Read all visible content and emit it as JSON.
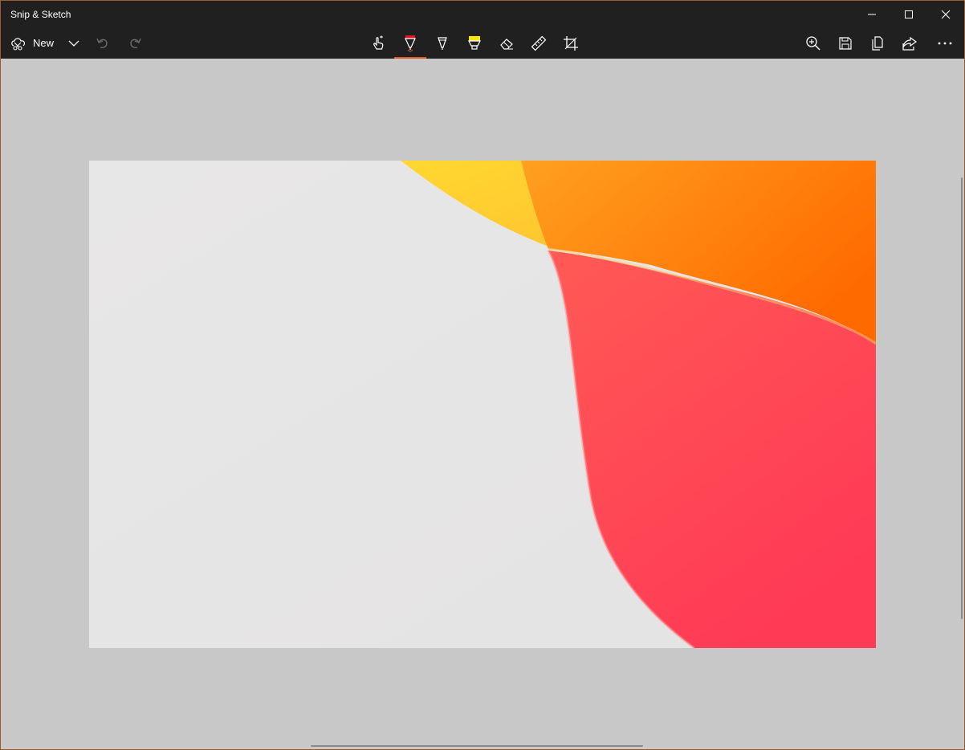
{
  "window": {
    "title": "Snip & Sketch",
    "controls": {
      "minimize_icon": "minimize-icon",
      "maximize_icon": "maximize-icon",
      "close_icon": "close-icon"
    }
  },
  "toolbar": {
    "new_label": "New",
    "left_tools": [
      "new-snip-icon",
      "chevron-down-icon",
      "undo-icon",
      "redo-icon"
    ],
    "center_tools": [
      "touch-writing-icon",
      "ballpoint-pen-icon",
      "pencil-icon",
      "highlighter-icon",
      "eraser-icon",
      "ruler-icon",
      "crop-icon"
    ],
    "right_tools": [
      "zoom-icon",
      "save-icon",
      "copy-icon",
      "share-icon",
      "more-icon"
    ],
    "active_tool": "ballpoint-pen",
    "colors": {
      "pen": "#e81123",
      "highlighter": "#ffe600",
      "active_accent": "#e05a28",
      "bar": "#202020"
    }
  },
  "canvas": {
    "background": "#c8c8c8",
    "image_colors": {
      "base": "#e6e6e6",
      "yellow": "#ffd43a",
      "orange": "#ff7a00",
      "red": "#ff3d5c"
    }
  }
}
